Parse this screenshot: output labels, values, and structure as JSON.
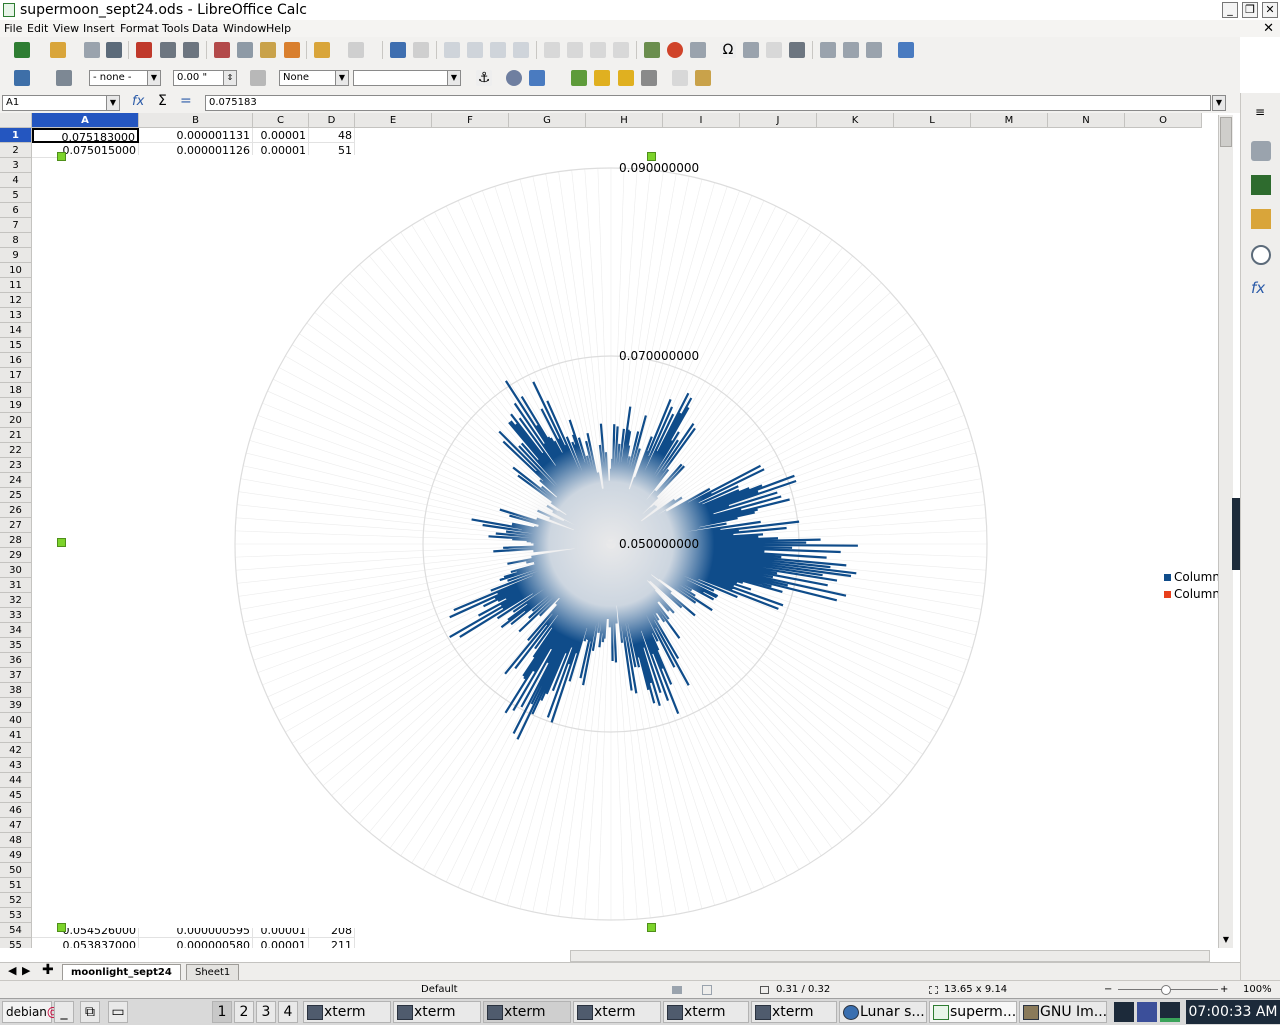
{
  "window": {
    "title": "supermoon_sept24.ods - LibreOffice Calc"
  },
  "menu": [
    "File",
    "Edit",
    "View",
    "Insert",
    "Format",
    "Tools",
    "Data",
    "Window",
    "Help"
  ],
  "format_bar": {
    "line_style": "- none -",
    "line_width": "0.00 \"",
    "area_style": "None",
    "area_fill": ""
  },
  "formula_bar": {
    "cell_ref": "A1",
    "content": "0.075183"
  },
  "columns": [
    "A",
    "B",
    "C",
    "D",
    "E",
    "F",
    "G",
    "H",
    "I",
    "J",
    "K",
    "L",
    "M",
    "N",
    "O"
  ],
  "rows": [
    {
      "n": "1",
      "a": "0.075183000",
      "b": "0.000001131",
      "c": "0.00001",
      "d": "48"
    },
    {
      "n": "2",
      "a": "0.075015000",
      "b": "0.000001126",
      "c": "0.00001",
      "d": "51"
    },
    {
      "n": "54",
      "a": "0.054526000",
      "b": "0.000000595",
      "c": "0.00001",
      "d": "208"
    },
    {
      "n": "55",
      "a": "0.053837000",
      "b": "0.000000580",
      "c": "0.00001",
      "d": "211"
    }
  ],
  "row_numbers": [
    "1",
    "2",
    "3",
    "4",
    "5",
    "6",
    "7",
    "8",
    "9",
    "10",
    "11",
    "12",
    "13",
    "14",
    "15",
    "16",
    "17",
    "18",
    "19",
    "20",
    "21",
    "22",
    "23",
    "24",
    "25",
    "26",
    "27",
    "28",
    "29",
    "30",
    "31",
    "32",
    "33",
    "34",
    "35",
    "36",
    "37",
    "38",
    "39",
    "40",
    "41",
    "42",
    "43",
    "44",
    "45",
    "46",
    "47",
    "48",
    "49",
    "50",
    "51",
    "52",
    "53",
    "54",
    "55"
  ],
  "chart_data": {
    "type": "polar-line",
    "radial_ticks": [
      "0.050000000",
      "0.070000000",
      "0.090000000"
    ],
    "rlim": [
      0.05,
      0.09
    ],
    "legend": [
      "Column",
      "Column"
    ],
    "legend_placement": "right",
    "series_colors": [
      "#0f4c8a",
      "#e8401c"
    ],
    "radius_profile": [
      0.058,
      0.061,
      0.057,
      0.066,
      0.06,
      0.055,
      0.052,
      0.063,
      0.068,
      0.062,
      0.071,
      0.074,
      0.066,
      0.06,
      0.057,
      0.055,
      0.058,
      0.062,
      0.066,
      0.061,
      0.057,
      0.059,
      0.064,
      0.07,
      0.064,
      0.058,
      0.062,
      0.066,
      0.06,
      0.055,
      0.058,
      0.061,
      0.056,
      0.053,
      0.057,
      0.062,
      0.066,
      0.064,
      0.06,
      0.056
    ]
  },
  "sheets": {
    "active": "moonlight_sept24",
    "other": "Sheet1"
  },
  "status": {
    "page_style": "Default",
    "position": "0.31 / 0.32",
    "size": "13.65 x 9.14",
    "zoom": "100%"
  },
  "taskbar": {
    "start": "debian",
    "desktops": [
      "1",
      "2",
      "3",
      "4"
    ],
    "tasks": [
      "xterm",
      "xterm",
      "xterm",
      "xterm",
      "xterm",
      "xterm",
      "Lunar s...",
      "superm...",
      "GNU Im..."
    ],
    "clock": "07:00:33 AM"
  }
}
